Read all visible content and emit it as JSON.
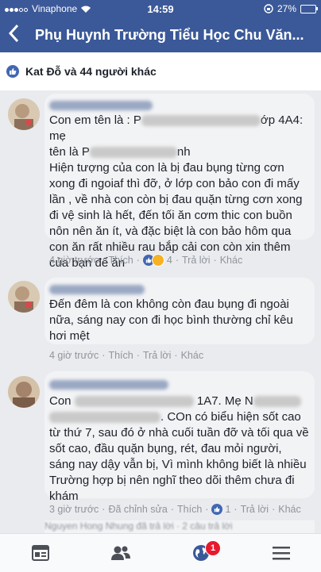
{
  "status_bar": {
    "carrier": "Vinaphone",
    "time": "14:59",
    "battery_level": "27%",
    "battery_fraction": 0.27,
    "signal_bars": 3
  },
  "nav": {
    "back_icon": "chevron-left-icon",
    "title": "Phụ Huynh Trường Tiểu Học Chu Văn..."
  },
  "likes_summary": {
    "text": "Kat Đỗ và 44 người khác"
  },
  "comments": [
    {
      "name_redacted": "T..... ...ng Đinh",
      "lines": [
        "Con em tên là : P............................ớp 4A4: mẹ",
        "tên là P.................. ...nh",
        "Hiện tượng của con là bị đau bụng từng cơn",
        "xong đi ngoiaf thì đỡ, ở lớp con bảo con đi mấy",
        "lần , về nhà con còn bị đau quặn từng cơn xong",
        "đi vệ sinh là hết, đến tối ăn cơm thic con buồn",
        "nôn nên ăn ít, và đặc biệt là con bảo hôm qua",
        "con ăn rất nhiều rau bắp cải con còn xin thêm",
        "của bạn để ăn"
      ],
      "time": "4 giờ trước",
      "like": "Thích",
      "reaction_count": "4",
      "reply": "Trả lời",
      "other": "Khác"
    },
    {
      "lines": [
        "Đến đêm là con không còn đau bụng đi ngoài",
        "nữa, sáng nay con đi học bình thường chỉ kêu",
        "hơi mệt"
      ],
      "time": "4 giờ trước",
      "like": "Thích",
      "reply": "Trả lời",
      "other": "Khác"
    },
    {
      "name_redacted": "Nguyen Hong Nhung",
      "line1_end": "1A7. Mẹ N",
      "line2_end": ". COn có biểu hiện sốt cao",
      "lines": [
        "từ thứ 7, sau đó ở nhà cuối tuần đỡ và tối qua về",
        "sốt cao, đầu quặn bụng, rét, đau mỏi người,",
        "sáng nay dậy vẫn bị, Vì mình không biết là nhiều",
        "Trường hợp bị nên nghĩ theo dõi thêm chưa đi",
        "khám"
      ],
      "time": "3 giờ trước",
      "edited": "Đã chỉnh sửa",
      "like": "Thích",
      "reaction_count": "1",
      "reply": "Trả lời",
      "other": "Khác",
      "reply_preview": "Nguyen Hong Nhung đã trả lời · 2 câu trả lời"
    }
  ],
  "tab_bar": {
    "items": [
      "news-feed-icon",
      "friends-icon",
      "globe-notifications-icon",
      "menu-icon"
    ],
    "notification_badge": "1"
  },
  "colors": {
    "brand": "#3b5998",
    "link": "#365899",
    "meta": "#90949c",
    "badge": "#e8192c"
  }
}
